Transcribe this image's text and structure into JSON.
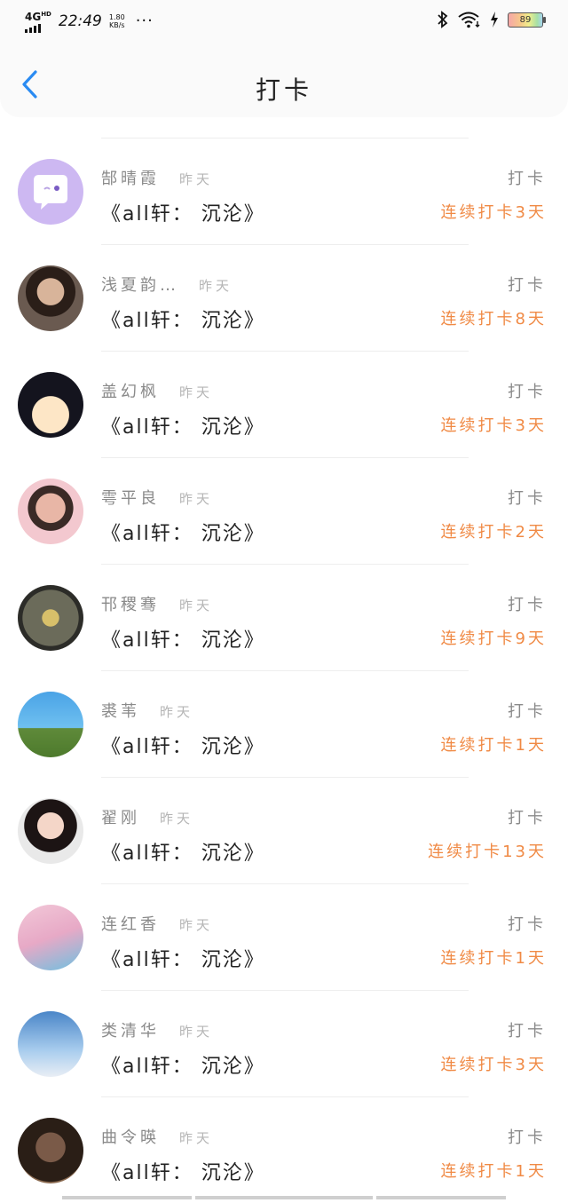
{
  "status_bar": {
    "network": "4G",
    "network_sup": "HD",
    "time": "22:49",
    "speed_value": "1.80",
    "speed_unit": "KB/s",
    "more": "···",
    "battery": "89"
  },
  "header": {
    "title": "打卡",
    "back_icon": "chevron-left-icon",
    "accent": "#2a8bf2"
  },
  "colors": {
    "streak": "#f08a45",
    "muted": "#8a8a8a"
  },
  "rows": [
    {
      "name": "郜晴霞",
      "when": "昨天",
      "book": "《all轩： 沉沦》",
      "action": "打卡",
      "streak": "连续打卡3天"
    },
    {
      "name": "浅夏韵…",
      "when": "昨天",
      "book": "《all轩： 沉沦》",
      "action": "打卡",
      "streak": "连续打卡8天"
    },
    {
      "name": "盖幻枫",
      "when": "昨天",
      "book": "《all轩： 沉沦》",
      "action": "打卡",
      "streak": "连续打卡3天"
    },
    {
      "name": "雩平良",
      "when": "昨天",
      "book": "《all轩： 沉沦》",
      "action": "打卡",
      "streak": "连续打卡2天"
    },
    {
      "name": "邗稷骞",
      "when": "昨天",
      "book": "《all轩： 沉沦》",
      "action": "打卡",
      "streak": "连续打卡9天"
    },
    {
      "name": "裘苇",
      "when": "昨天",
      "book": "《all轩： 沉沦》",
      "action": "打卡",
      "streak": "连续打卡1天"
    },
    {
      "name": "翟刚",
      "when": "昨天",
      "book": "《all轩： 沉沦》",
      "action": "打卡",
      "streak": "连续打卡13天"
    },
    {
      "name": "连红香",
      "when": "昨天",
      "book": "《all轩： 沉沦》",
      "action": "打卡",
      "streak": "连续打卡1天"
    },
    {
      "name": "类清华",
      "when": "昨天",
      "book": "《all轩： 沉沦》",
      "action": "打卡",
      "streak": "连续打卡3天"
    },
    {
      "name": "曲令暎",
      "when": "昨天",
      "book": "《all轩： 沉沦》",
      "action": "打卡",
      "streak": "连续打卡1天"
    }
  ]
}
